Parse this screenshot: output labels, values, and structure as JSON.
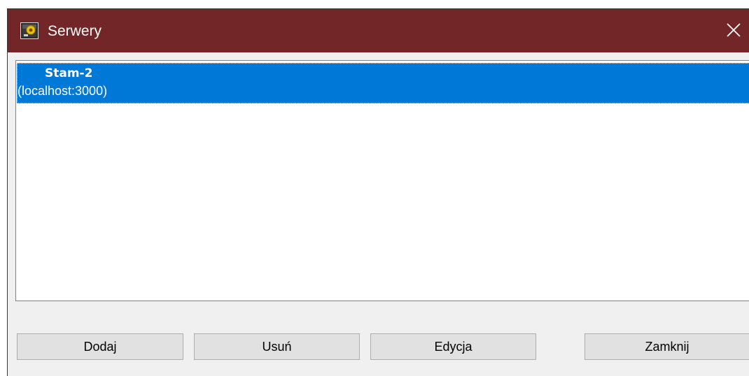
{
  "window": {
    "title": "Serwery",
    "title_bar_color": "#722627",
    "app_icon": "server-app-icon",
    "close_icon": "close-icon"
  },
  "server_list": {
    "selected_color": "#0078d7",
    "items": [
      {
        "name": "Stam-2",
        "address": "(localhost:3000)",
        "selected": true
      }
    ]
  },
  "buttons": {
    "add_label": "Dodaj",
    "remove_label": "Usuń",
    "edit_label": "Edycja",
    "close_label": "Zamknij"
  }
}
